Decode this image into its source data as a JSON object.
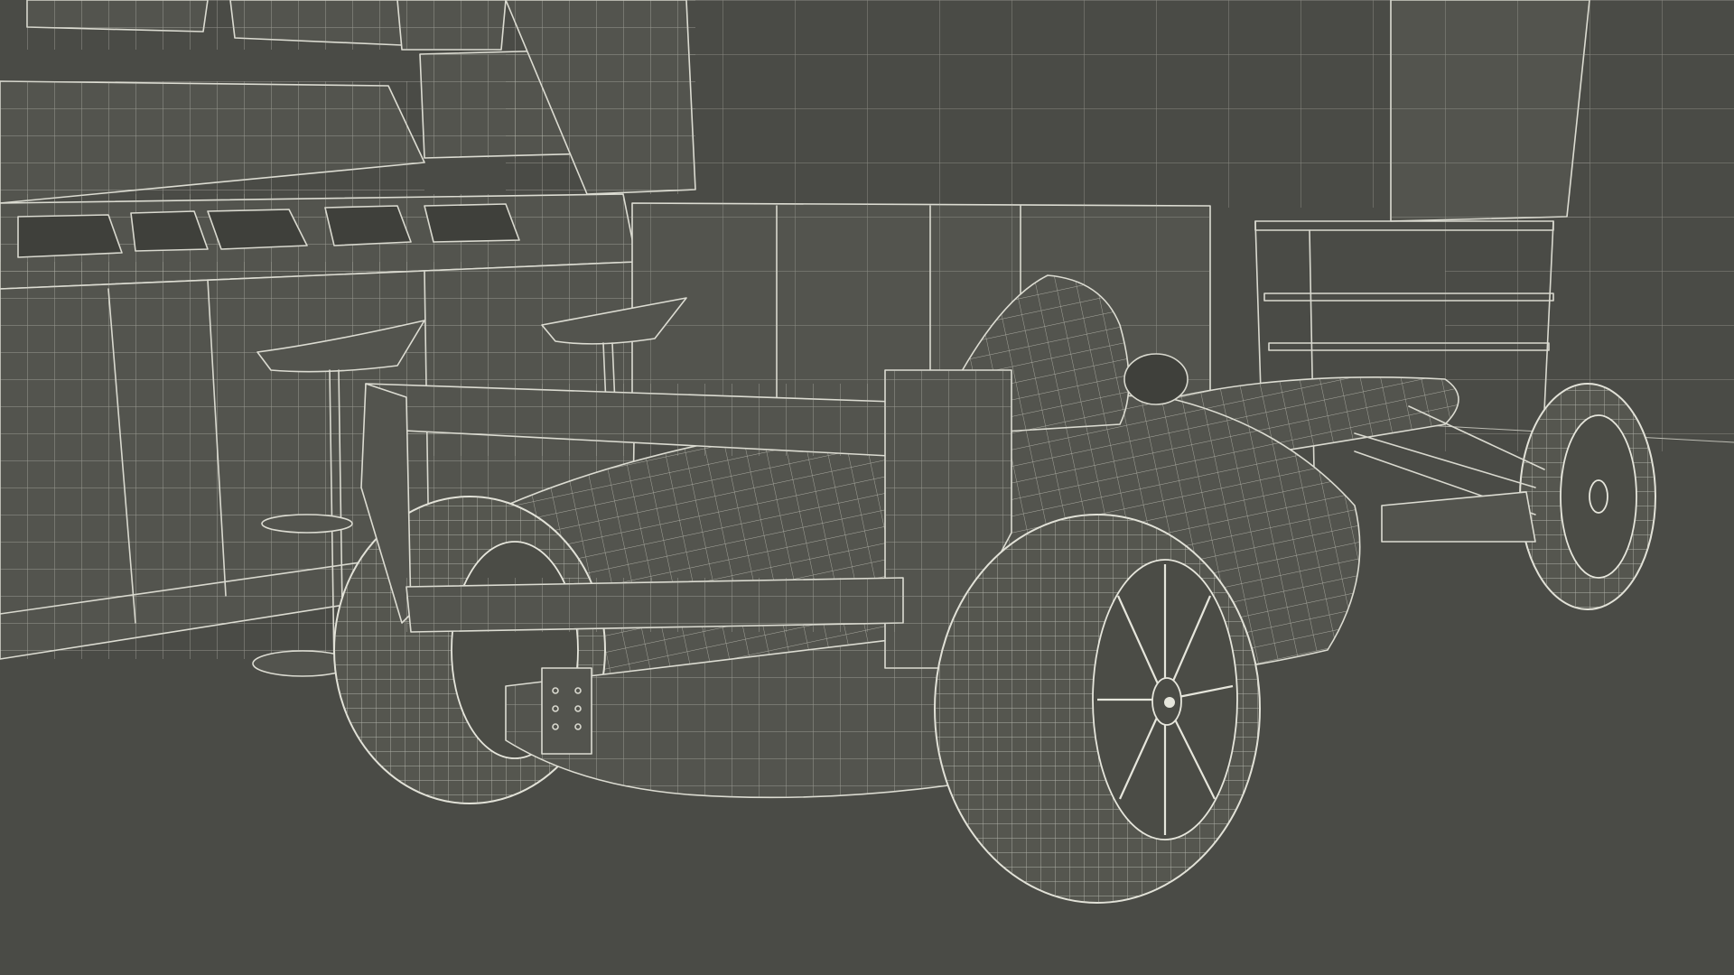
{
  "scene": {
    "kind": "3d-wireframe-render",
    "subject": "formula-e-race-car",
    "environment": "pit-garage",
    "colors": {
      "background": "#4a4b46",
      "wire": "#d9d9cf",
      "floor": "#484944"
    },
    "objects": [
      "back-wall",
      "pit-counter",
      "bar-stools",
      "garage-partition",
      "tool-shelf",
      "race-car"
    ]
  }
}
